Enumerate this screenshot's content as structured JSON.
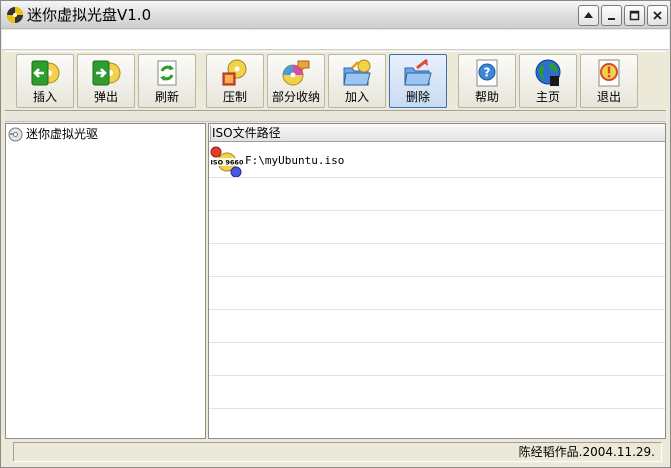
{
  "window": {
    "title": "迷你虚拟光盘V1.0"
  },
  "titlebar_buttons": [
    {
      "name": "help",
      "symbol": "▲"
    },
    {
      "name": "minimize",
      "symbol": "_"
    },
    {
      "name": "maximize",
      "symbol": "□"
    },
    {
      "name": "close",
      "symbol": "×"
    }
  ],
  "toolbar": {
    "buttons": [
      {
        "id": "insert",
        "label": "插入",
        "icon": "insert-disc-icon"
      },
      {
        "id": "eject",
        "label": "弹出",
        "icon": "eject-disc-icon"
      },
      {
        "id": "refresh",
        "label": "刷新",
        "icon": "refresh-icon"
      },
      {
        "id": "compress",
        "label": "压制",
        "icon": "compress-disc-icon"
      },
      {
        "id": "partial",
        "label": "部分收纳",
        "icon": "partial-collect-icon"
      },
      {
        "id": "add",
        "label": "加入",
        "icon": "add-folder-icon"
      },
      {
        "id": "delete",
        "label": "删除",
        "icon": "delete-folder-icon"
      },
      {
        "id": "help",
        "label": "帮助",
        "icon": "help-icon"
      },
      {
        "id": "home",
        "label": "主页",
        "icon": "homepage-globe-icon"
      },
      {
        "id": "exit",
        "label": "退出",
        "icon": "exit-icon"
      }
    ],
    "active": "delete"
  },
  "tree": {
    "root_label": "迷你虚拟光驱"
  },
  "list": {
    "column_header": "ISO文件路径",
    "rows": [
      {
        "iso_label": "ISO 9660",
        "path": "F:\\myUbuntu.iso"
      }
    ]
  },
  "status": {
    "text": "陈经韬作品.2004.11.29."
  },
  "colors": {
    "chrome": "#ece9d8",
    "active_border": "#3c6fb4"
  }
}
